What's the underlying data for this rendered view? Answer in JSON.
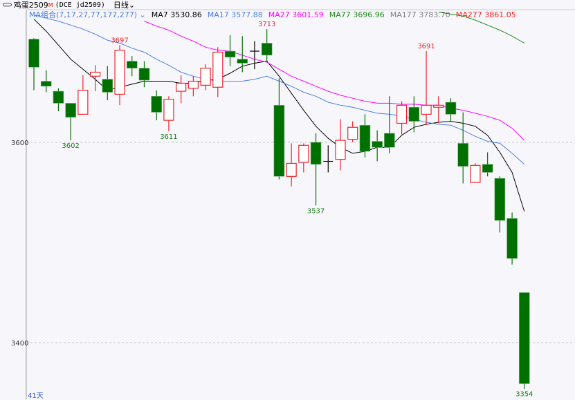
{
  "header": {
    "icon": "chain-link-icon",
    "symbol_name": "鸡蛋2509",
    "main_flag": "M",
    "exchange_code": "(DCE jd2509)",
    "period": "日线"
  },
  "legend": {
    "combo_label": "MA组合(7,17,27,77,177,277)",
    "items": [
      {
        "name": "MA7",
        "value": "3530.86",
        "color": "#000000"
      },
      {
        "name": "MA17",
        "value": "3577.88",
        "color": "#4a7ee6"
      },
      {
        "name": "MA27",
        "value": "3601.59",
        "color": "#ff00ff"
      },
      {
        "name": "MA77",
        "value": "3696.96",
        "color": "#1a8a1a"
      },
      {
        "name": "MA177",
        "value": "3783.70",
        "color": "#808080"
      },
      {
        "name": "MA277",
        "value": "3861.05",
        "color": "#ff2020"
      }
    ]
  },
  "footer": {
    "day_count": "41天"
  },
  "chart_data": {
    "type": "candlestick",
    "y_ticks": [
      "3600",
      "3400"
    ],
    "y_tick_values": [
      3600,
      3400
    ],
    "ylim": [
      3343,
      3742
    ],
    "colors": {
      "up": "#e8252a",
      "down": "#007000",
      "doji": "#000000"
    },
    "candles": [
      [
        3703,
        3675,
        3704,
        3652
      ],
      [
        3661,
        3656,
        3672,
        3650
      ],
      [
        3651,
        3639,
        3654,
        3631
      ],
      [
        3639,
        3625,
        3639,
        3602
      ],
      [
        3628,
        3652,
        3667,
        3628
      ],
      [
        3666,
        3670,
        3677,
        3651
      ],
      [
        3663,
        3650,
        3676,
        3642
      ],
      [
        3648,
        3692,
        3697,
        3637
      ],
      [
        3681,
        3674,
        3686,
        3666
      ],
      [
        3674,
        3662,
        3681,
        3655
      ],
      [
        3646,
        3630,
        3652,
        3622
      ],
      [
        3622,
        3643,
        3646,
        3611
      ],
      [
        3651,
        3659,
        3667,
        3639
      ],
      [
        3654,
        3661,
        3666,
        3646
      ],
      [
        3657,
        3674,
        3678,
        3652
      ],
      [
        3655,
        3690,
        3695,
        3645
      ],
      [
        3691,
        3685,
        3707,
        3676
      ],
      [
        3683,
        3679,
        3706,
        3670
      ],
      [
        3691,
        3691,
        3701,
        3673
      ],
      [
        3699,
        3687,
        3713,
        3681
      ],
      [
        3637,
        3566,
        3664,
        3563
      ],
      [
        3566,
        3579,
        3599,
        3556
      ],
      [
        3580,
        3597,
        3599,
        3570
      ],
      [
        3600,
        3578,
        3609,
        3537
      ],
      [
        3581,
        3581,
        3597,
        3570
      ],
      [
        3583,
        3602,
        3623,
        3572
      ],
      [
        3603,
        3615,
        3621,
        3600
      ],
      [
        3617,
        3591,
        3628,
        3585
      ],
      [
        3601,
        3595,
        3612,
        3581
      ],
      [
        3609,
        3595,
        3646,
        3589
      ],
      [
        3619,
        3637,
        3641,
        3608
      ],
      [
        3635,
        3621,
        3646,
        3610
      ],
      [
        3628,
        3637,
        3691,
        3617
      ],
      [
        3635,
        3637,
        3646,
        3619
      ],
      [
        3640,
        3628,
        3644,
        3621
      ],
      [
        3599,
        3576,
        3630,
        3559
      ],
      [
        3560,
        3577,
        3579,
        3560
      ],
      [
        3578,
        3570,
        3590,
        3566
      ],
      [
        3564,
        3522,
        3566,
        3510
      ],
      [
        3524,
        3484,
        3530,
        3478
      ],
      [
        3450,
        3359,
        3450,
        3354
      ]
    ],
    "candle_format": [
      "open",
      "close",
      "high",
      "low"
    ],
    "annotations": [
      {
        "index": 3,
        "label": "3602",
        "kind": "low"
      },
      {
        "index": 7,
        "label": "3697",
        "kind": "high"
      },
      {
        "index": 11,
        "label": "3611",
        "kind": "low"
      },
      {
        "index": 19,
        "label": "3713",
        "kind": "high"
      },
      {
        "index": 23,
        "label": "3537",
        "kind": "low"
      },
      {
        "index": 32,
        "label": "3691",
        "kind": "high"
      },
      {
        "index": 40,
        "label": "3354",
        "kind": "low"
      }
    ],
    "ma_series": [
      {
        "name": "MA7",
        "start": 0,
        "color": "#000000",
        "values": [
          3723,
          3711,
          3697,
          3683,
          3673,
          3663,
          3652,
          3655,
          3658,
          3661,
          3661,
          3661,
          3659,
          3659,
          3662,
          3663,
          3669,
          3676,
          3679,
          3681,
          3666,
          3649,
          3632,
          3616,
          3604,
          3595,
          3589,
          3591,
          3595,
          3595,
          3607,
          3615,
          3618,
          3620,
          3621,
          3619,
          3616,
          3607,
          3590,
          3570,
          3531
        ]
      },
      {
        "name": "MA17",
        "start": 0,
        "color": "#4a7ee6",
        "values": [
          3727,
          3724,
          3721,
          3717,
          3713,
          3708,
          3702,
          3699,
          3694,
          3690,
          3683,
          3677,
          3670,
          3666,
          3663,
          3661,
          3661,
          3661,
          3663,
          3666,
          3661,
          3656,
          3650,
          3646,
          3640,
          3637,
          3635,
          3632,
          3629,
          3628,
          3626,
          3623,
          3620,
          3618,
          3617,
          3612,
          3606,
          3601,
          3599,
          3589,
          3578
        ]
      },
      {
        "name": "MA27",
        "start": 9,
        "color": "#ff00ff",
        "values": [
          3721,
          3716,
          3712,
          3706,
          3701,
          3695,
          3692,
          3691,
          3687,
          3683,
          3680,
          3673,
          3666,
          3661,
          3656,
          3651,
          3647,
          3644,
          3641,
          3639,
          3639,
          3638,
          3638,
          3637,
          3637,
          3634,
          3632,
          3629,
          3626,
          3622,
          3614,
          3602
        ]
      },
      {
        "name": "MA77",
        "start": 33,
        "color": "#1a8a1a",
        "values": [
          3730,
          3728,
          3726,
          3722,
          3717,
          3712,
          3706,
          3699
        ]
      }
    ]
  }
}
